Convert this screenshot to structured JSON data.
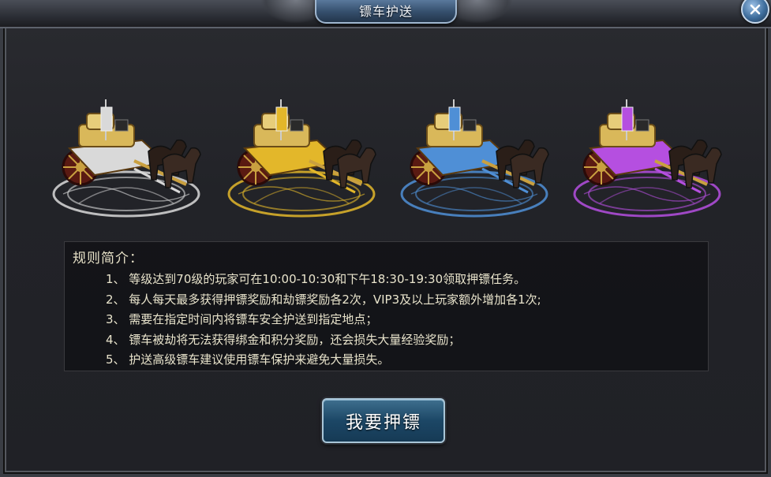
{
  "window": {
    "title": "镖车护送"
  },
  "carts": [
    {
      "tier": "white",
      "accent": "#d9d9d9"
    },
    {
      "tier": "gold",
      "accent": "#e3b72a"
    },
    {
      "tier": "blue",
      "accent": "#4f8fd6"
    },
    {
      "tier": "purple",
      "accent": "#b54fe0"
    }
  ],
  "rules": {
    "title": "规则简介：",
    "items": [
      "1、 等级达到70级的玩家可在10:00-10:30和下午18:30-19:30领取押镖任务。",
      "2、 每人每天最多获得押镖奖励和劫镖奖励各2次，VIP3及以上玩家额外增加各1次;",
      "3、 需要在指定时间内将镖车安全护送到指定地点；",
      "4、 镖车被劫将无法获得绑金和积分奖励，还会损失大量经验奖励；",
      "5、 护送高级镖车建议使用镖车保护来避免大量损失。"
    ]
  },
  "actions": {
    "escort_label": "我要押镖"
  },
  "icons": {
    "close": "close-icon"
  }
}
